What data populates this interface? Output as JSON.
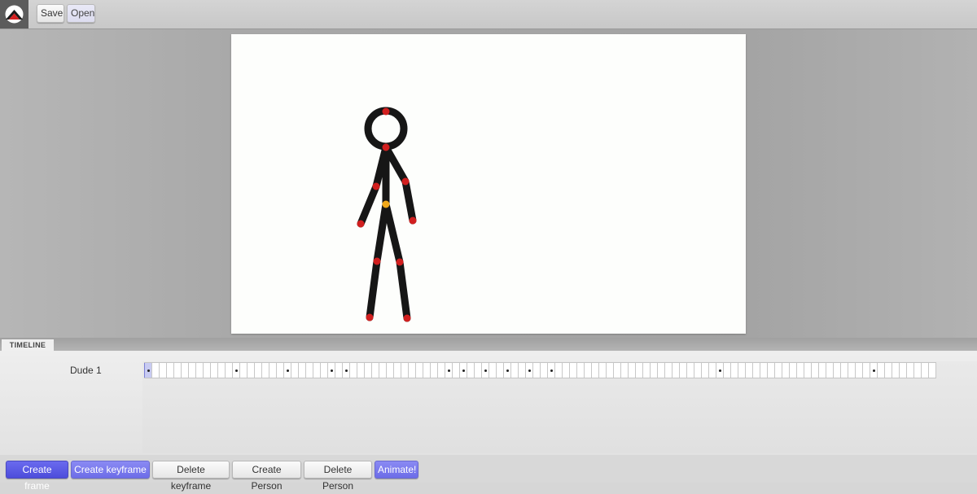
{
  "toolbar": {
    "logo_icon": "app-logo-icon",
    "save_label": "Save",
    "open_label": "Open"
  },
  "timeline": {
    "tab_label": "TIMELINE",
    "tracks": [
      {
        "name": "Dude 1",
        "frame_count": 108,
        "selected_frame": 1,
        "keyframes": [
          1,
          13,
          20,
          26,
          28,
          42,
          44,
          47,
          50,
          53,
          56,
          79,
          100
        ]
      }
    ]
  },
  "buttons": {
    "create_frame": "Create frame",
    "create_keyframe": "Create keyframe",
    "delete_keyframe": "Delete keyframe",
    "create_person": "Create Person",
    "delete_person": "Delete Person",
    "animate": "Animate!"
  },
  "colors": {
    "joint": "#d11f1f",
    "center_joint": "#f0a81a",
    "limb": "#161616",
    "primary_button": "#5555e6",
    "secondary_button": "#7777ee",
    "selected_frame": "#c8cbf2"
  }
}
